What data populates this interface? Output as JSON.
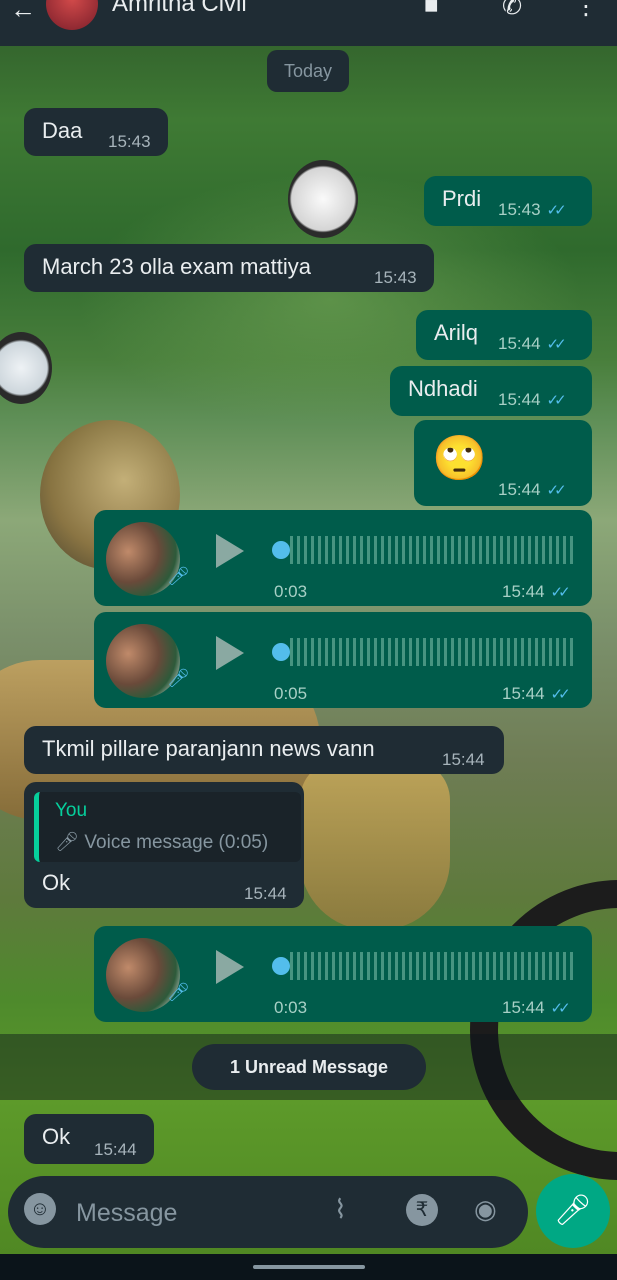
{
  "header": {
    "contact_name": "Amritha Civil",
    "back_icon": "arrow-left-icon",
    "video_icon": "video-call-icon",
    "phone_icon": "phone-icon",
    "menu_icon": "more-vert-icon"
  },
  "date_label": "Today",
  "messages": [
    {
      "dir": "in",
      "text": "Daa",
      "time": "15:43"
    },
    {
      "dir": "out",
      "text": "Prdi",
      "time": "15:43"
    },
    {
      "dir": "in",
      "text": "March 23 olla exam mattiya",
      "time": "15:43"
    },
    {
      "dir": "out",
      "text": "Arilq",
      "time": "15:44"
    },
    {
      "dir": "out",
      "text": "Ndhadi",
      "time": "15:44"
    },
    {
      "dir": "out",
      "text": "🙄",
      "time": "15:44"
    },
    {
      "dir": "out",
      "type": "voice",
      "duration": "0:03",
      "time": "15:44"
    },
    {
      "dir": "out",
      "type": "voice",
      "duration": "0:05",
      "time": "15:44"
    },
    {
      "dir": "in",
      "text": "Tkmil pillare paranjann news vann",
      "time": "15:44"
    },
    {
      "dir": "in",
      "reply_to": "You",
      "reply_preview": "Voice message (0:05)",
      "text": "Ok",
      "time": "15:44"
    },
    {
      "dir": "out",
      "type": "voice",
      "duration": "0:03",
      "time": "15:44"
    },
    {
      "dir": "in",
      "text": "Ok",
      "time": "15:44"
    }
  ],
  "unread_label": "1 Unread Message",
  "composer": {
    "placeholder": "Message",
    "emoji_icon": "emoji-icon",
    "attach_icon": "paperclip-icon",
    "payment_icon": "rupee-icon",
    "camera_icon": "camera-icon",
    "mic_icon": "mic-icon"
  },
  "colors": {
    "incoming_bubble": "#1f2c34",
    "outgoing_bubble": "#005c4b",
    "accent": "#00a884",
    "read_tick": "#53bdeb"
  }
}
